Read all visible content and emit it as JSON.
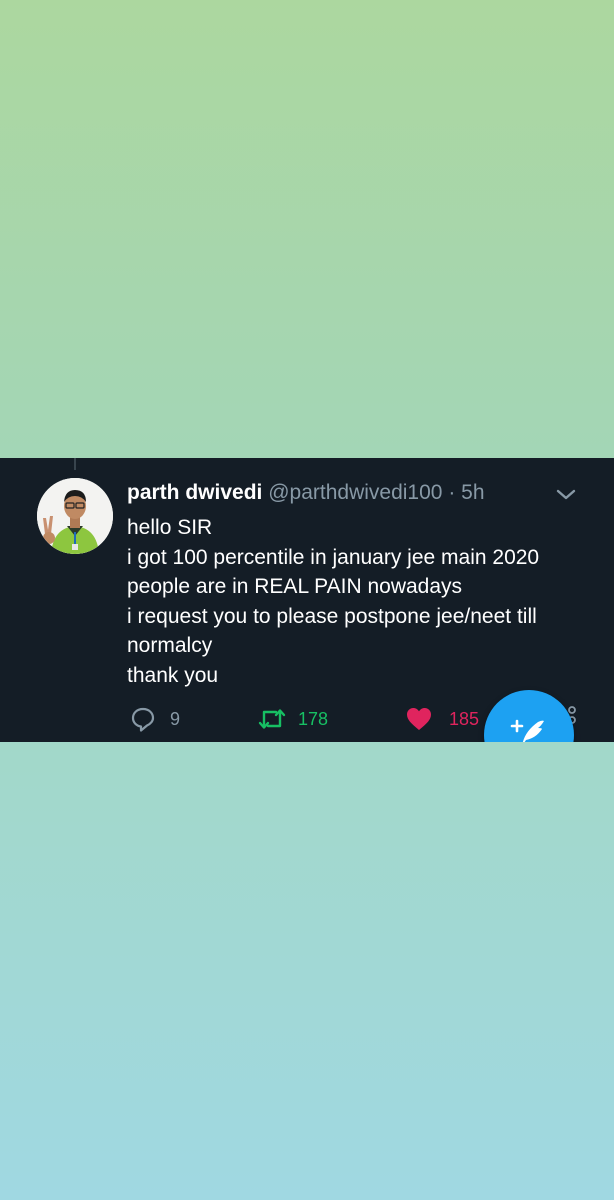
{
  "tweet": {
    "display_name": "parth dwivedi",
    "handle": "@parthdwivedi100",
    "separator": "·",
    "time": "5h",
    "lines": [
      "hello SIR",
      "i got 100 percentile in january jee main 2020",
      "people are in REAL PAIN nowadays",
      "i request you to please postpone jee/neet till",
      "normalcy",
      "thank you"
    ],
    "actions": {
      "replies": "9",
      "retweets": "178",
      "likes": "185"
    }
  },
  "colors": {
    "card_background": "#141d26",
    "secondary_text": "#8899a6",
    "retweet_green": "#17bf63",
    "like_red": "#e0245e",
    "fab_blue": "#1da1f2"
  },
  "icons": {
    "reply": "reply-icon",
    "retweet": "retweet-icon",
    "like": "heart-icon",
    "more": "chevron-down-icon",
    "compose": "compose-tweet-icon",
    "share": "share-icon"
  }
}
